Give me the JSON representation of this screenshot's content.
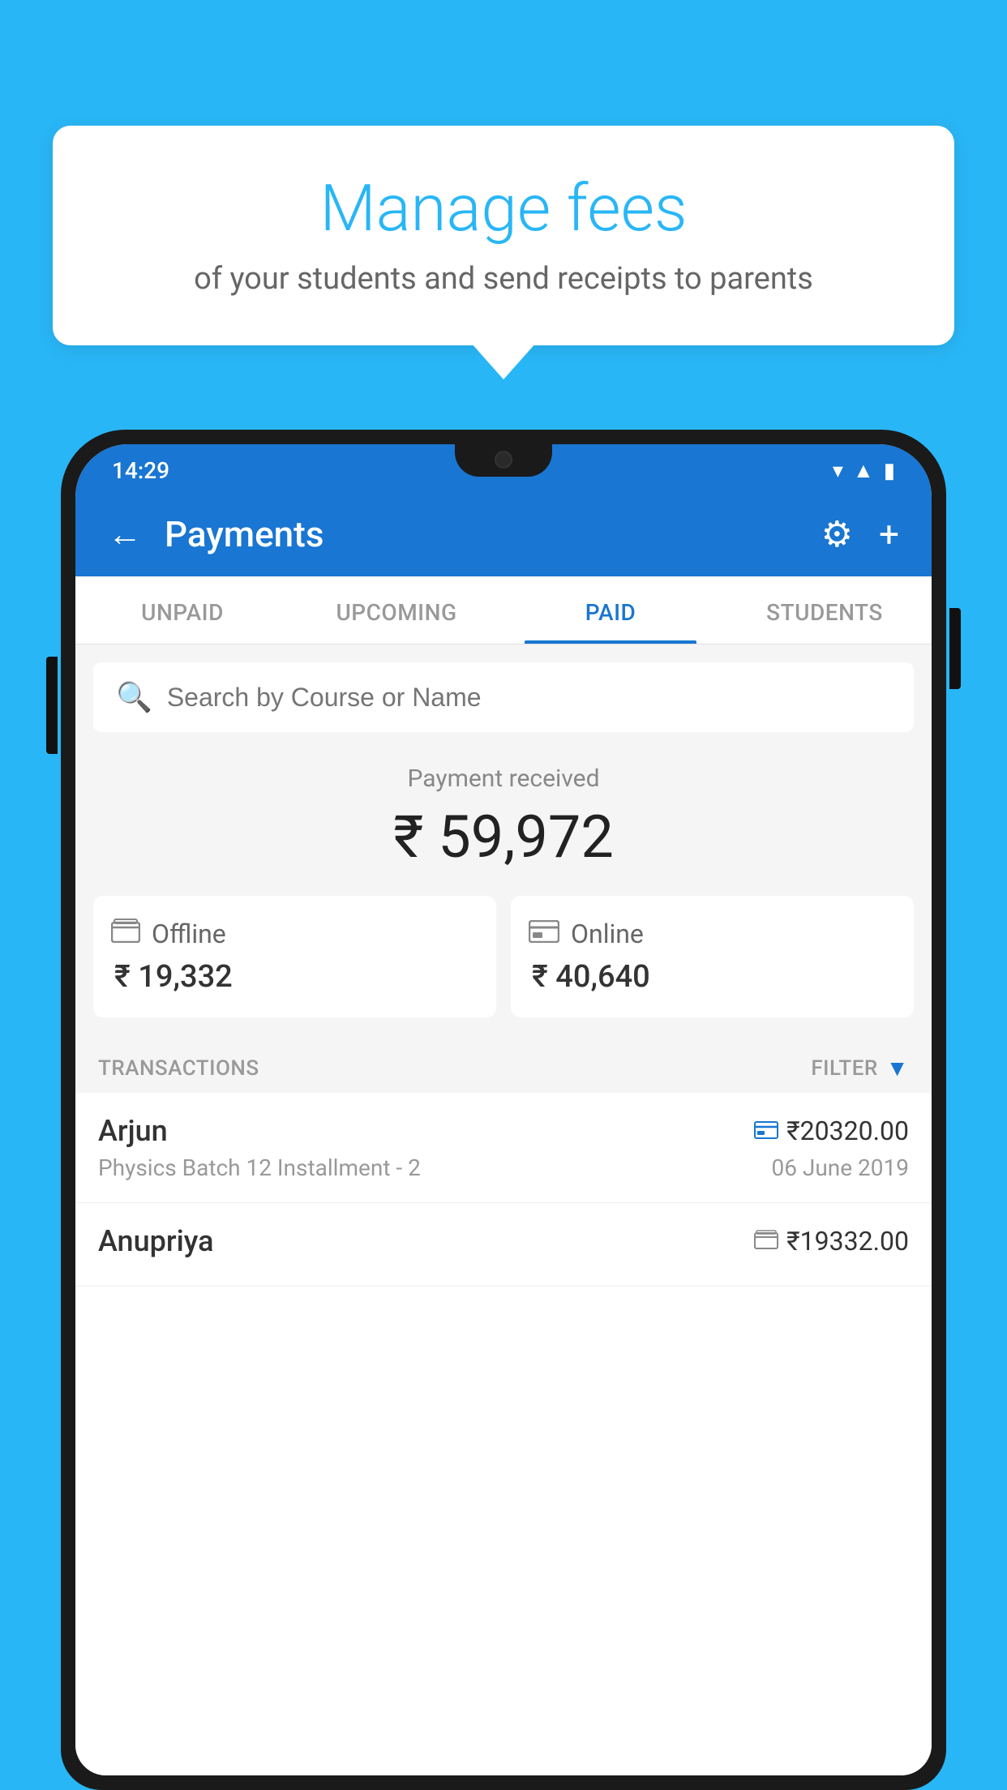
{
  "background_color": "#29b6f6",
  "speech_bubble": {
    "title": "Manage fees",
    "subtitle": "of your students and send receipts to parents"
  },
  "status_bar": {
    "time": "14:29",
    "wifi": "▾",
    "signal": "▲",
    "battery": "▮"
  },
  "app_bar": {
    "title": "Payments",
    "back_label": "←",
    "gear_label": "⚙",
    "plus_label": "+"
  },
  "tabs": [
    {
      "label": "UNPAID",
      "active": false
    },
    {
      "label": "UPCOMING",
      "active": false
    },
    {
      "label": "PAID",
      "active": true
    },
    {
      "label": "STUDENTS",
      "active": false
    }
  ],
  "search": {
    "placeholder": "Search by Course or Name"
  },
  "payment_summary": {
    "label": "Payment received",
    "amount": "₹ 59,972"
  },
  "payment_cards": [
    {
      "icon": "offline",
      "label": "Offline",
      "amount": "₹ 19,332"
    },
    {
      "icon": "online",
      "label": "Online",
      "amount": "₹ 40,640"
    }
  ],
  "transactions_header": {
    "label": "TRANSACTIONS",
    "filter_label": "FILTER"
  },
  "transactions": [
    {
      "name": "Arjun",
      "description": "Physics Batch 12 Installment - 2",
      "amount": "₹20320.00",
      "date": "06 June 2019",
      "payment_type": "online"
    },
    {
      "name": "Anupriya",
      "description": "",
      "amount": "₹19332.00",
      "date": "",
      "payment_type": "offline"
    }
  ]
}
